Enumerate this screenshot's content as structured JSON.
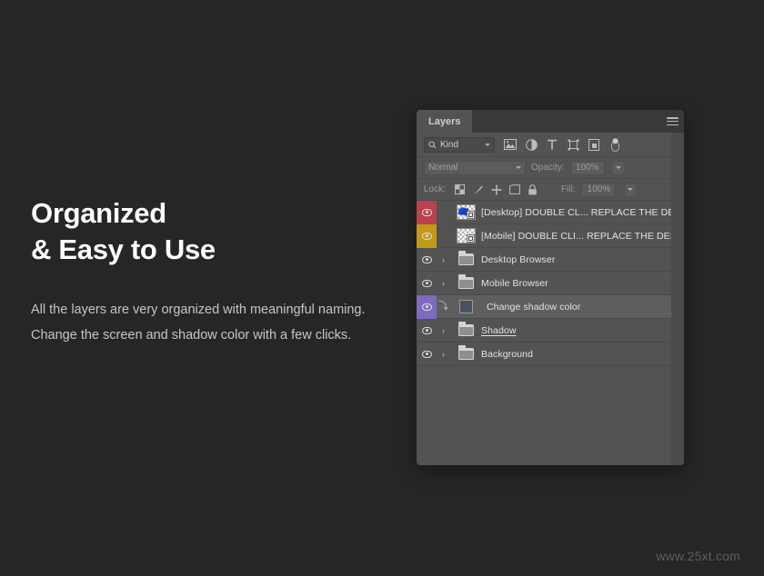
{
  "colors": {
    "background": "#262626",
    "panel": "#535353",
    "panel_header": "#393939",
    "label_red": "#b8434c",
    "label_yellow": "#c29a17",
    "label_violet": "#7e6bbf",
    "shadow_swatch": "#4b5165",
    "headline": "#ffffff",
    "body_text": "#c6c6c6",
    "watermark": "#5e5e5e"
  },
  "marketing": {
    "headline_line1": "Organized",
    "headline_line2": "& Easy to Use",
    "body": "All the layers are very organized with meaningful naming. Change the screen and shadow color with a few clicks."
  },
  "watermark": {
    "text": "www.25xt.com"
  },
  "panel": {
    "tab_label": "Layers",
    "menu_icon": "hamburger-menu-icon",
    "filter": {
      "kind_label": "Kind",
      "search_icon": "search-icon",
      "caret_icon": "chevron-down-icon",
      "icons": [
        {
          "name": "pixel-layer-filter-icon",
          "title": "Pixel layers"
        },
        {
          "name": "adjustment-layer-filter-icon",
          "title": "Adjustment layers"
        },
        {
          "name": "type-layer-filter-icon",
          "title": "Type layers"
        },
        {
          "name": "shape-layer-filter-icon",
          "title": "Shape layers"
        },
        {
          "name": "smart-object-filter-icon",
          "title": "Smart objects"
        },
        {
          "name": "filter-toggle-switch-icon",
          "title": "Turn filtering on/off"
        }
      ]
    },
    "blend": {
      "mode_label": "Normal",
      "opacity_label": "Opacity:",
      "opacity_value": "100%",
      "caret_icon": "chevron-down-icon"
    },
    "lock": {
      "label": "Lock:",
      "fill_label": "Fill:",
      "fill_value": "100%",
      "icons": [
        {
          "name": "lock-transparent-pixels-icon"
        },
        {
          "name": "lock-image-pixels-icon"
        },
        {
          "name": "lock-position-icon"
        },
        {
          "name": "lock-artboard-nesting-icon"
        },
        {
          "name": "lock-all-icon"
        }
      ]
    },
    "layers": [
      {
        "name": "[Desktop] DOUBLE CL... REPLACE THE DESIGN",
        "label_color": "#b8434c",
        "visible": true,
        "type": "smart-object",
        "has_art": true,
        "selected": false,
        "underlined": false,
        "expandable": false
      },
      {
        "name": "[Mobile] DOUBLE CLI... REPLACE THE DESIGN",
        "label_color": "#c29a17",
        "visible": true,
        "type": "smart-object",
        "has_art": false,
        "selected": false,
        "underlined": false,
        "expandable": false
      },
      {
        "name": "Desktop Browser",
        "label_color": "",
        "visible": true,
        "type": "group",
        "has_art": false,
        "selected": false,
        "underlined": false,
        "expandable": true
      },
      {
        "name": "Mobile Browser",
        "label_color": "",
        "visible": true,
        "type": "group",
        "has_art": false,
        "selected": false,
        "underlined": false,
        "expandable": true
      },
      {
        "name": "Change shadow color",
        "label_color": "#7e6bbf",
        "visible": true,
        "type": "solid-color-clipped",
        "swatch_color": "#4b5165",
        "has_art": false,
        "selected": true,
        "underlined": false,
        "expandable": false
      },
      {
        "name": "Shadow",
        "label_color": "",
        "visible": true,
        "type": "group",
        "has_art": false,
        "selected": false,
        "underlined": true,
        "expandable": true
      },
      {
        "name": "Background",
        "label_color": "",
        "visible": true,
        "type": "group",
        "has_art": false,
        "selected": false,
        "underlined": false,
        "expandable": true
      }
    ]
  }
}
